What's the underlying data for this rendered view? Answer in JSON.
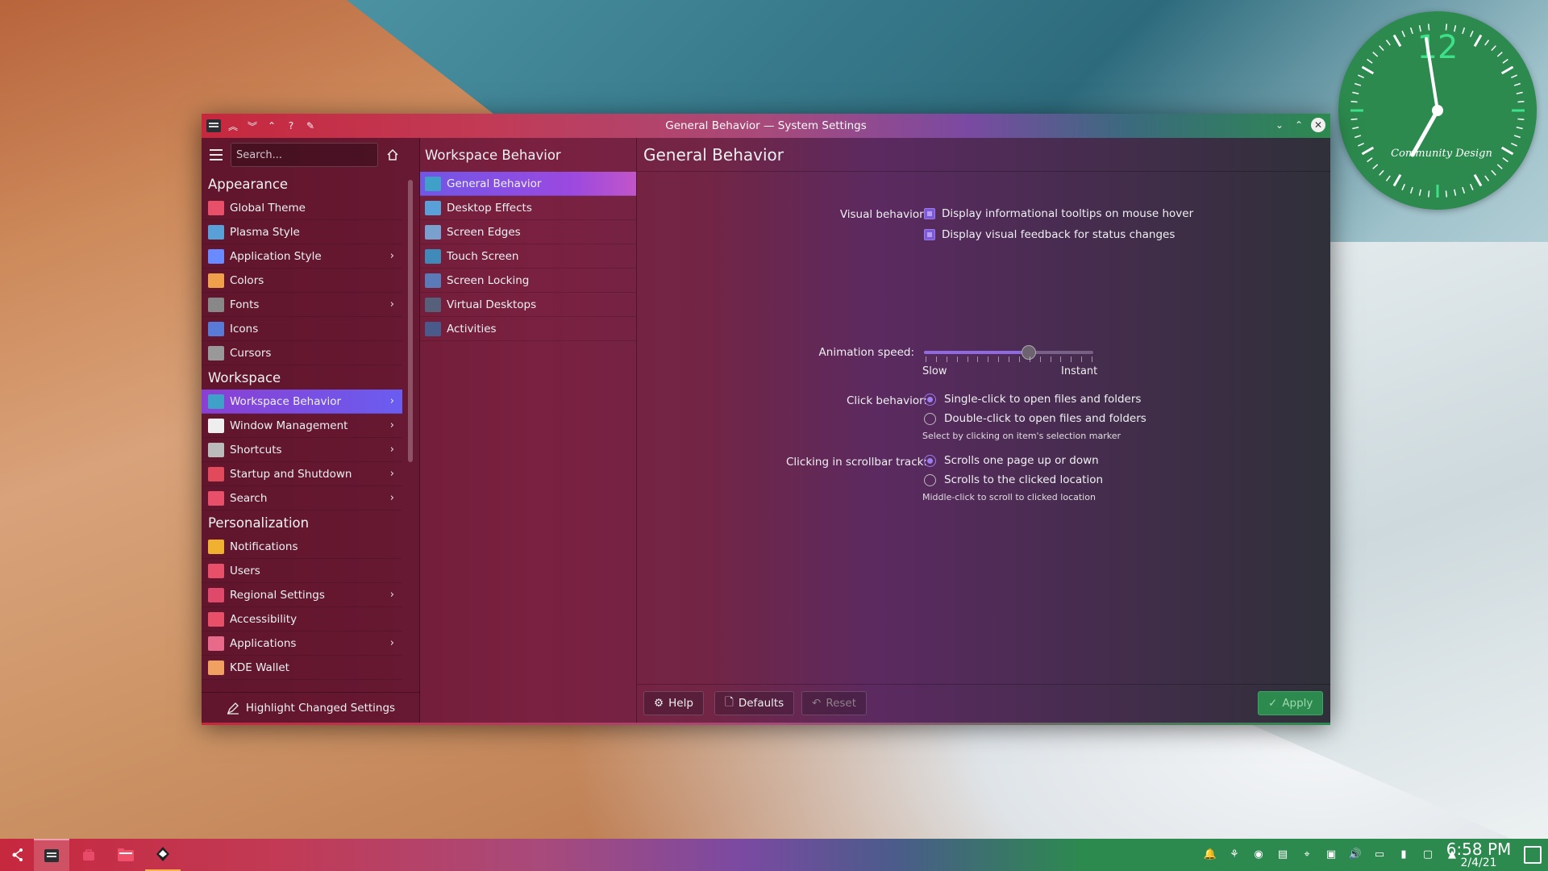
{
  "window": {
    "title": "General Behavior — System Settings"
  },
  "search": {
    "placeholder": "Search..."
  },
  "sidebar": {
    "categories": [
      {
        "name": "Appearance",
        "items": [
          {
            "label": "Global Theme",
            "icon": "global-theme-icon"
          },
          {
            "label": "Plasma Style",
            "icon": "plasma-style-icon"
          },
          {
            "label": "Application Style",
            "icon": "application-style-icon",
            "expandable": true
          },
          {
            "label": "Colors",
            "icon": "colors-icon"
          },
          {
            "label": "Fonts",
            "icon": "fonts-icon",
            "expandable": true
          },
          {
            "label": "Icons",
            "icon": "icons-icon"
          },
          {
            "label": "Cursors",
            "icon": "cursors-icon"
          }
        ]
      },
      {
        "name": "Workspace",
        "items": [
          {
            "label": "Workspace Behavior",
            "icon": "workspace-behavior-icon",
            "expandable": true,
            "selected": true
          },
          {
            "label": "Window Management",
            "icon": "window-management-icon",
            "expandable": true
          },
          {
            "label": "Shortcuts",
            "icon": "shortcuts-icon",
            "expandable": true
          },
          {
            "label": "Startup and Shutdown",
            "icon": "startup-shutdown-icon",
            "expandable": true
          },
          {
            "label": "Search",
            "icon": "search-icon",
            "expandable": true
          }
        ]
      },
      {
        "name": "Personalization",
        "items": [
          {
            "label": "Notifications",
            "icon": "bell-icon"
          },
          {
            "label": "Users",
            "icon": "users-icon"
          },
          {
            "label": "Regional Settings",
            "icon": "regional-settings-icon",
            "expandable": true
          },
          {
            "label": "Accessibility",
            "icon": "accessibility-icon"
          },
          {
            "label": "Applications",
            "icon": "applications-icon",
            "expandable": true
          },
          {
            "label": "KDE Wallet",
            "icon": "wallet-icon"
          }
        ]
      }
    ],
    "highlight_label": "Highlight Changed Settings"
  },
  "subpanel": {
    "title": "Workspace Behavior",
    "items": [
      {
        "label": "General Behavior",
        "selected": true
      },
      {
        "label": "Desktop Effects"
      },
      {
        "label": "Screen Edges"
      },
      {
        "label": "Touch Screen"
      },
      {
        "label": "Screen Locking"
      },
      {
        "label": "Virtual Desktops"
      },
      {
        "label": "Activities"
      }
    ]
  },
  "content": {
    "title": "General Behavior",
    "visual_behavior_label": "Visual behavior:",
    "tooltips_label": "Display informational tooltips on mouse hover",
    "tooltips_checked": true,
    "feedback_label": "Display visual feedback for status changes",
    "feedback_checked": true,
    "animation_label": "Animation speed:",
    "animation_value": 0.62,
    "slow_label": "Slow",
    "instant_label": "Instant",
    "click_label": "Click behavior:",
    "single_click_label": "Single-click to open files and folders",
    "double_click_label": "Double-click to open files and folders",
    "click_hint": "Select by clicking on item's selection marker",
    "scrollbar_label": "Clicking in scrollbar track:",
    "scroll_page_label": "Scrolls one page up or down",
    "scroll_location_label": "Scrolls to the clicked location",
    "scroll_hint": "Middle-click to scroll to clicked location"
  },
  "footer": {
    "help_label": "Help",
    "defaults_label": "Defaults",
    "reset_label": "Reset",
    "apply_label": "Apply"
  },
  "clock": {
    "text": "Community Design",
    "top_numeral": "12"
  },
  "taskbar": {
    "time": "6:58 PM",
    "date": "2/4/21"
  },
  "colors": {
    "accent": "#8a3fd2",
    "apply_green": "#2c8a4e"
  }
}
